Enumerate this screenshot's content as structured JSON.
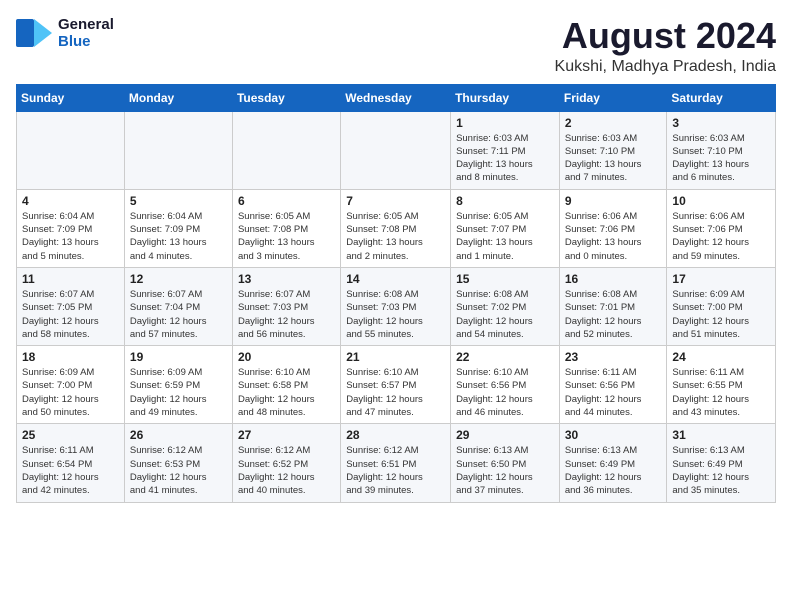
{
  "logo": {
    "line1": "General",
    "line2": "Blue"
  },
  "title": "August 2024",
  "subtitle": "Kukshi, Madhya Pradesh, India",
  "days_of_week": [
    "Sunday",
    "Monday",
    "Tuesday",
    "Wednesday",
    "Thursday",
    "Friday",
    "Saturday"
  ],
  "weeks": [
    [
      {
        "day": "",
        "info": ""
      },
      {
        "day": "",
        "info": ""
      },
      {
        "day": "",
        "info": ""
      },
      {
        "day": "",
        "info": ""
      },
      {
        "day": "1",
        "info": "Sunrise: 6:03 AM\nSunset: 7:11 PM\nDaylight: 13 hours\nand 8 minutes."
      },
      {
        "day": "2",
        "info": "Sunrise: 6:03 AM\nSunset: 7:10 PM\nDaylight: 13 hours\nand 7 minutes."
      },
      {
        "day": "3",
        "info": "Sunrise: 6:03 AM\nSunset: 7:10 PM\nDaylight: 13 hours\nand 6 minutes."
      }
    ],
    [
      {
        "day": "4",
        "info": "Sunrise: 6:04 AM\nSunset: 7:09 PM\nDaylight: 13 hours\nand 5 minutes."
      },
      {
        "day": "5",
        "info": "Sunrise: 6:04 AM\nSunset: 7:09 PM\nDaylight: 13 hours\nand 4 minutes."
      },
      {
        "day": "6",
        "info": "Sunrise: 6:05 AM\nSunset: 7:08 PM\nDaylight: 13 hours\nand 3 minutes."
      },
      {
        "day": "7",
        "info": "Sunrise: 6:05 AM\nSunset: 7:08 PM\nDaylight: 13 hours\nand 2 minutes."
      },
      {
        "day": "8",
        "info": "Sunrise: 6:05 AM\nSunset: 7:07 PM\nDaylight: 13 hours\nand 1 minute."
      },
      {
        "day": "9",
        "info": "Sunrise: 6:06 AM\nSunset: 7:06 PM\nDaylight: 13 hours\nand 0 minutes."
      },
      {
        "day": "10",
        "info": "Sunrise: 6:06 AM\nSunset: 7:06 PM\nDaylight: 12 hours\nand 59 minutes."
      }
    ],
    [
      {
        "day": "11",
        "info": "Sunrise: 6:07 AM\nSunset: 7:05 PM\nDaylight: 12 hours\nand 58 minutes."
      },
      {
        "day": "12",
        "info": "Sunrise: 6:07 AM\nSunset: 7:04 PM\nDaylight: 12 hours\nand 57 minutes."
      },
      {
        "day": "13",
        "info": "Sunrise: 6:07 AM\nSunset: 7:03 PM\nDaylight: 12 hours\nand 56 minutes."
      },
      {
        "day": "14",
        "info": "Sunrise: 6:08 AM\nSunset: 7:03 PM\nDaylight: 12 hours\nand 55 minutes."
      },
      {
        "day": "15",
        "info": "Sunrise: 6:08 AM\nSunset: 7:02 PM\nDaylight: 12 hours\nand 54 minutes."
      },
      {
        "day": "16",
        "info": "Sunrise: 6:08 AM\nSunset: 7:01 PM\nDaylight: 12 hours\nand 52 minutes."
      },
      {
        "day": "17",
        "info": "Sunrise: 6:09 AM\nSunset: 7:00 PM\nDaylight: 12 hours\nand 51 minutes."
      }
    ],
    [
      {
        "day": "18",
        "info": "Sunrise: 6:09 AM\nSunset: 7:00 PM\nDaylight: 12 hours\nand 50 minutes."
      },
      {
        "day": "19",
        "info": "Sunrise: 6:09 AM\nSunset: 6:59 PM\nDaylight: 12 hours\nand 49 minutes."
      },
      {
        "day": "20",
        "info": "Sunrise: 6:10 AM\nSunset: 6:58 PM\nDaylight: 12 hours\nand 48 minutes."
      },
      {
        "day": "21",
        "info": "Sunrise: 6:10 AM\nSunset: 6:57 PM\nDaylight: 12 hours\nand 47 minutes."
      },
      {
        "day": "22",
        "info": "Sunrise: 6:10 AM\nSunset: 6:56 PM\nDaylight: 12 hours\nand 46 minutes."
      },
      {
        "day": "23",
        "info": "Sunrise: 6:11 AM\nSunset: 6:56 PM\nDaylight: 12 hours\nand 44 minutes."
      },
      {
        "day": "24",
        "info": "Sunrise: 6:11 AM\nSunset: 6:55 PM\nDaylight: 12 hours\nand 43 minutes."
      }
    ],
    [
      {
        "day": "25",
        "info": "Sunrise: 6:11 AM\nSunset: 6:54 PM\nDaylight: 12 hours\nand 42 minutes."
      },
      {
        "day": "26",
        "info": "Sunrise: 6:12 AM\nSunset: 6:53 PM\nDaylight: 12 hours\nand 41 minutes."
      },
      {
        "day": "27",
        "info": "Sunrise: 6:12 AM\nSunset: 6:52 PM\nDaylight: 12 hours\nand 40 minutes."
      },
      {
        "day": "28",
        "info": "Sunrise: 6:12 AM\nSunset: 6:51 PM\nDaylight: 12 hours\nand 39 minutes."
      },
      {
        "day": "29",
        "info": "Sunrise: 6:13 AM\nSunset: 6:50 PM\nDaylight: 12 hours\nand 37 minutes."
      },
      {
        "day": "30",
        "info": "Sunrise: 6:13 AM\nSunset: 6:49 PM\nDaylight: 12 hours\nand 36 minutes."
      },
      {
        "day": "31",
        "info": "Sunrise: 6:13 AM\nSunset: 6:49 PM\nDaylight: 12 hours\nand 35 minutes."
      }
    ]
  ]
}
